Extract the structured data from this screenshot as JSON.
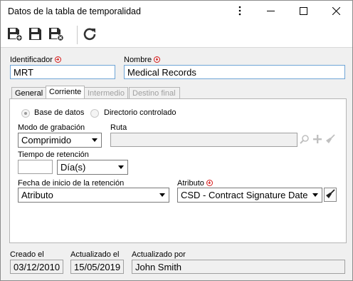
{
  "window": {
    "title": "Datos de la tabla de temporalidad"
  },
  "fields": {
    "identificador_label": "Identificador",
    "identificador_value": "MRT",
    "nombre_label": "Nombre",
    "nombre_value": "Medical Records"
  },
  "tabs": [
    {
      "label": "General"
    },
    {
      "label": "Corriente"
    },
    {
      "label": "Intermedio"
    },
    {
      "label": "Destino final"
    }
  ],
  "corriente": {
    "radio_base": "Base de datos",
    "radio_directorio": "Directorio controlado",
    "modo_label": "Modo de grabación",
    "modo_value": "Comprimido",
    "ruta_label": "Ruta",
    "ruta_value": "",
    "tiempo_label": "Tiempo de retención",
    "tiempo_value": "",
    "tiempo_unit": "Día(s)",
    "fecha_label": "Fecha de inicio de la retención",
    "fecha_value": "Atributo",
    "atributo_label": "Atributo",
    "atributo_value": "CSD - Contract Signature Date"
  },
  "footer": {
    "creado_label": "Creado el",
    "creado_value": "03/12/2010",
    "actualizado_label": "Actualizado el",
    "actualizado_value": "15/05/2019",
    "actualizado_por_label": "Actualizado por",
    "actualizado_por_value": "John Smith"
  },
  "colors": {
    "accent_border": "#6fa5d6",
    "required": "#d61a1a",
    "refresh": "#333333"
  }
}
